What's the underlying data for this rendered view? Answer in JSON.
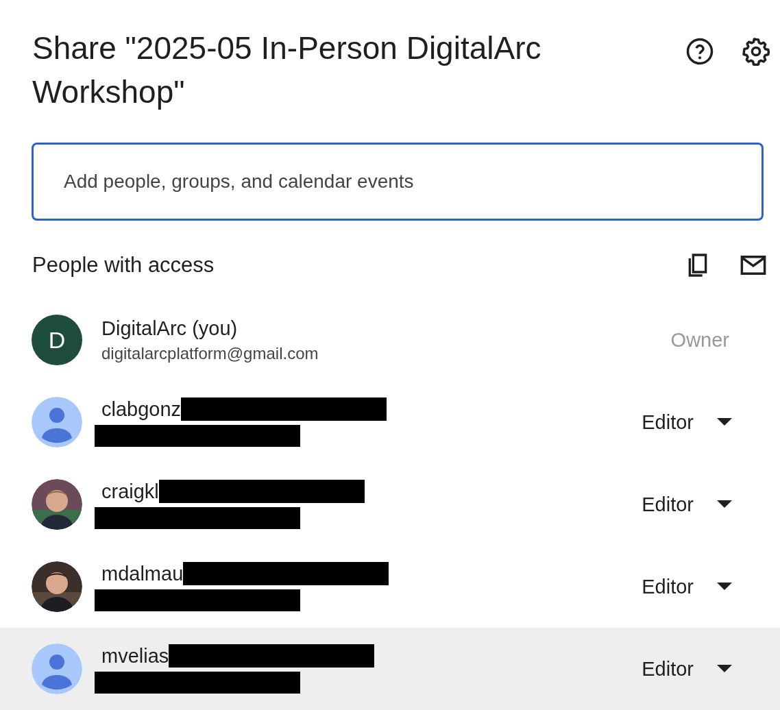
{
  "title": "Share \"2025-05 In-Person DigitalArc Workshop\"",
  "search": {
    "placeholder": "Add people, groups, and calendar events"
  },
  "section_title": "People with access",
  "people": [
    {
      "name": "DigitalArc (you)",
      "email": "digitalarcplatform@gmail.com",
      "avatar": {
        "kind": "initial",
        "letter": "D"
      },
      "role": "Owner",
      "role_editable": false,
      "redacted": false,
      "highlighted": false
    },
    {
      "name": "clabgonz",
      "avatar": {
        "kind": "silhouette"
      },
      "role": "Editor",
      "role_editable": true,
      "redacted": true,
      "highlighted": false
    },
    {
      "name": "craigkl",
      "role": "Editor",
      "role_editable": true,
      "redacted": true,
      "highlighted": false
    },
    {
      "name": "mdalmau",
      "role": "Editor",
      "role_editable": true,
      "redacted": true,
      "highlighted": false
    },
    {
      "name": "mvelias",
      "avatar": {
        "kind": "silhouette"
      },
      "role": "Editor",
      "role_editable": true,
      "redacted": true,
      "highlighted": true
    }
  ]
}
